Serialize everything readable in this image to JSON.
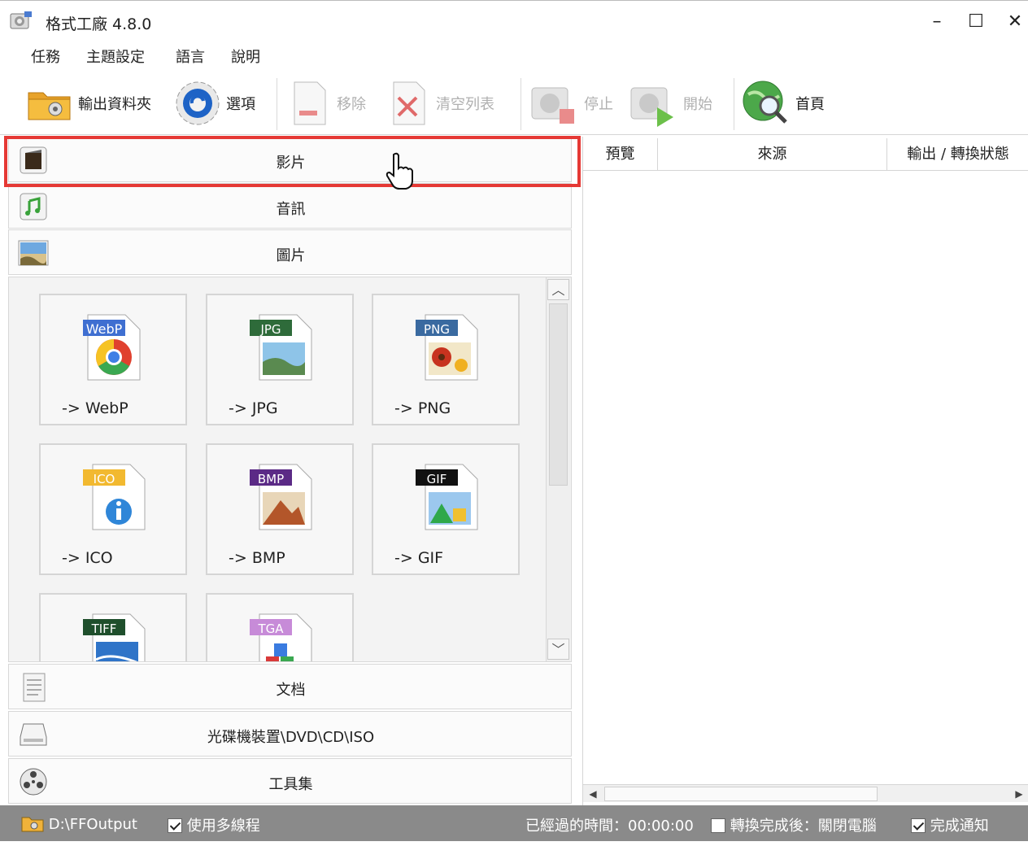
{
  "window": {
    "title": "格式工廠 4.8.0",
    "controls": {
      "minimize": "–",
      "maximize": "☐",
      "close": "✕"
    }
  },
  "menu": {
    "items": [
      "任務",
      "主題設定",
      "語言",
      "說明"
    ]
  },
  "toolbar": {
    "output_folder": "輸出資料夾",
    "options": "選項",
    "remove": "移除",
    "clear_list": "清空列表",
    "stop": "停止",
    "start": "開始",
    "home": "首頁"
  },
  "categories": {
    "video": "影片",
    "audio": "音訊",
    "image": "圖片",
    "document": "文档",
    "disc": "光碟機裝置\\DVD\\CD\\ISO",
    "tools": "工具集"
  },
  "image_tiles": [
    {
      "label": "-> WebP",
      "badge": "WebP",
      "badge_color": "#3f6fd1"
    },
    {
      "label": "-> JPG",
      "badge": "JPG",
      "badge_color": "#2e6b3a"
    },
    {
      "label": "-> PNG",
      "badge": "PNG",
      "badge_color": "#3a6aa0"
    },
    {
      "label": "-> ICO",
      "badge": "ICO",
      "badge_color": "#f2b930"
    },
    {
      "label": "-> BMP",
      "badge": "BMP",
      "badge_color": "#5b2a86"
    },
    {
      "label": "-> GIF",
      "badge": "GIF",
      "badge_color": "#111111"
    },
    {
      "label": "",
      "badge": "TIFF",
      "badge_color": "#1f4f2c"
    },
    {
      "label": "",
      "badge": "TGA",
      "badge_color": "#c78bd8"
    }
  ],
  "task_list": {
    "columns": [
      "預覽",
      "來源",
      "輸出 / 轉換狀態"
    ]
  },
  "statusbar": {
    "output_path": "D:\\FFOutput",
    "multithread_label": "使用多線程",
    "multithread_checked": true,
    "elapsed": "已經過的時間：00:00:00",
    "after_convert_label": "轉換完成後：關閉電腦",
    "after_convert_checked": false,
    "notify_label": "完成通知",
    "notify_checked": true
  },
  "colors": {
    "highlight": "#e53935",
    "statusbar": "#8a8a8a"
  }
}
